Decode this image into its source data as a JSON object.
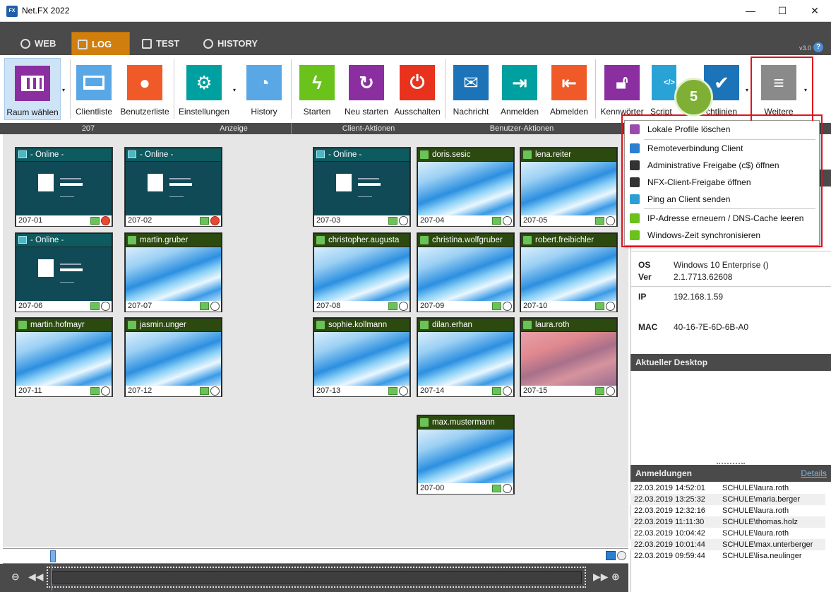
{
  "window": {
    "title": "Net.FX 2022",
    "icon": "netfx-app-icon",
    "minimize": "—",
    "maximize": "☐",
    "close": "✕"
  },
  "tabs": [
    {
      "label": "WEB",
      "icon": "globe-icon"
    },
    {
      "label": "LOG",
      "icon": "log-icon",
      "active": true
    },
    {
      "label": "TEST",
      "icon": "test-icon"
    },
    {
      "label": "HISTORY",
      "icon": "history-icon"
    }
  ],
  "version": "v3.0",
  "help": "?",
  "ribbon": {
    "buttons": [
      {
        "label": "Raum wählen",
        "icon": "room-icon",
        "color": "#8b2fa0"
      },
      {
        "label": "Clientliste",
        "icon": "laptop-icon",
        "color": "#5aa7e6"
      },
      {
        "label": "Benutzerliste",
        "icon": "user-icon",
        "color": "#f05a28"
      },
      {
        "label": "Einstellungen",
        "icon": "gears-icon",
        "color": "#00a0a0"
      },
      {
        "label": "History",
        "icon": "globe-clock-icon",
        "color": "#5aa7e6"
      },
      {
        "label": "Starten",
        "icon": "power-bolt-icon",
        "color": "#6ac21a"
      },
      {
        "label": "Neu starten",
        "icon": "restart-icon",
        "color": "#8b2fa0"
      },
      {
        "label": "Ausschalten",
        "icon": "power-icon",
        "color": "#e8321e"
      },
      {
        "label": "Nachricht",
        "icon": "mail-icon",
        "color": "#1c73b8"
      },
      {
        "label": "Anmelden",
        "icon": "login-icon",
        "color": "#00a0a0"
      },
      {
        "label": "Abmelden",
        "icon": "logout-icon",
        "color": "#f05a28"
      },
      {
        "label": "Kennwörter",
        "icon": "lock-icon",
        "color": "#8b2fa0"
      },
      {
        "label": "Script",
        "icon": "script-icon",
        "color": "#29a3d6"
      },
      {
        "label": "chtlinien",
        "icon": "shield-check-icon",
        "color": "#1c73b8"
      },
      {
        "label": "Weitere",
        "icon": "menu-icon",
        "color": "#8a8a8a"
      }
    ],
    "groups": {
      "g1": "207",
      "g2": "Anzeige",
      "g3": "Client-Aktionen",
      "g4": "Benutzer-Aktionen"
    }
  },
  "step_badge": "5",
  "menu": {
    "items": [
      {
        "label": "Lokale Profile löschen",
        "icon": "eraser-icon",
        "color": "#9b4bb0"
      },
      {
        "label": "Remoteverbindung Client",
        "icon": "cursor-icon",
        "color": "#2a7fd0"
      },
      {
        "label": "Administrative Freigabe (c$) öffnen",
        "icon": "star-icon",
        "color": "#333"
      },
      {
        "label": "NFX-Client-Freigabe öffnen",
        "icon": "star-icon",
        "color": "#333"
      },
      {
        "label": "Ping an Client senden",
        "icon": "wifi-icon",
        "color": "#2a9fd6"
      },
      {
        "label": "IP-Adresse erneuern / DNS-Cache leeren",
        "icon": "network-icon",
        "color": "#6ac21a"
      },
      {
        "label": "Windows-Zeit synchronisieren",
        "icon": "clock-icon",
        "color": "#6ac21a"
      }
    ]
  },
  "tiles": [
    {
      "header": "- Online -",
      "footer": "207-01",
      "kind": "online",
      "alert": true
    },
    {
      "header": "- Online -",
      "footer": "207-02",
      "kind": "online",
      "alert": true
    },
    {
      "header": "- Online -",
      "footer": "207-03",
      "kind": "online"
    },
    {
      "header": "doris.sesic",
      "footer": "207-04",
      "kind": "user"
    },
    {
      "header": "lena.reiter",
      "footer": "207-05",
      "kind": "user"
    },
    {
      "header": "- Online -",
      "footer": "207-06",
      "kind": "online"
    },
    {
      "header": "martin.gruber",
      "footer": "207-07",
      "kind": "user"
    },
    {
      "header": "christopher.augusta",
      "footer": "207-08",
      "kind": "user"
    },
    {
      "header": "christina.wolfgruber",
      "footer": "207-09",
      "kind": "user"
    },
    {
      "header": "robert.freibichler",
      "footer": "207-10",
      "kind": "user"
    },
    {
      "header": "martin.hofmayr",
      "footer": "207-11",
      "kind": "user"
    },
    {
      "header": "jasmin.unger",
      "footer": "207-12",
      "kind": "user"
    },
    {
      "header": "sophie.kollmann",
      "footer": "207-13",
      "kind": "user"
    },
    {
      "header": "dilan.erhan",
      "footer": "207-14",
      "kind": "user"
    },
    {
      "header": "laura.roth",
      "footer": "207-15",
      "kind": "user-pink"
    },
    {
      "header": "max.mustermann",
      "footer": "207-00",
      "kind": "user"
    }
  ],
  "details": {
    "os_key": "OS",
    "os_val": "Windows 10 Enterprise ()",
    "ver_key": "Ver",
    "ver_val": "2.1.7713.62608",
    "ip_key": "IP",
    "ip_val": "192.168.1.59",
    "mac_key": "MAC",
    "mac_val": "40-16-7E-6D-6B-A0"
  },
  "desktop_header": "Aktueller Desktop",
  "logins": {
    "header": "Anmeldungen",
    "details_link": "Details",
    "rows": [
      {
        "date": "22.03.2019 14:52:01",
        "user": "SCHULE\\laura.roth"
      },
      {
        "date": "22.03.2019 13:25:32",
        "user": "SCHULE\\maria.berger"
      },
      {
        "date": "22.03.2019 12:32:16",
        "user": "SCHULE\\laura.roth"
      },
      {
        "date": "22.03.2019 11:11:30",
        "user": "SCHULE\\thomas.holz"
      },
      {
        "date": "22.03.2019 10:04:42",
        "user": "SCHULE\\laura.roth"
      },
      {
        "date": "22.03.2019 10:01:44",
        "user": "SCHULE\\max.unterberger"
      },
      {
        "date": "22.03.2019 09:59:44",
        "user": "SCHULE\\lisa.neulinger"
      }
    ]
  }
}
